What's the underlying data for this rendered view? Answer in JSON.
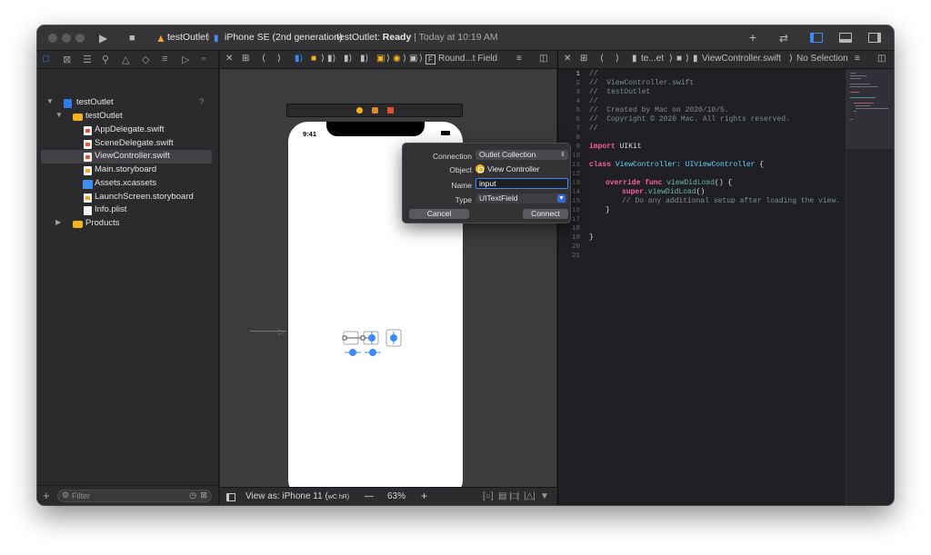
{
  "toolbar": {
    "scheme": "testOutlet",
    "destination": "iPhone SE (2nd generation)",
    "status_prefix": "testOutlet:",
    "status_state": "Ready",
    "status_time": "| Today at 10:19 AM"
  },
  "navigator": {
    "items": [
      {
        "label": "testOutlet",
        "badge": "?"
      },
      {
        "label": "testOutlet"
      },
      {
        "label": "AppDelegate.swift"
      },
      {
        "label": "SceneDelegate.swift"
      },
      {
        "label": "ViewController.swift"
      },
      {
        "label": "Main.storyboard"
      },
      {
        "label": "Assets.xcassets"
      },
      {
        "label": "LaunchScreen.storyboard"
      },
      {
        "label": "Info.plist"
      },
      {
        "label": "Products"
      }
    ],
    "filter_placeholder": "Filter"
  },
  "ib": {
    "jumpbar_last": "Round...t Field",
    "phone_time": "9:41",
    "view_as": "View as: iPhone 11 (",
    "view_as_keys": "wC hR)",
    "zoom": "63%"
  },
  "popover": {
    "connection_label": "Connection",
    "connection_value": "Outlet Collection",
    "object_label": "Object",
    "object_value": "View Controller",
    "name_label": "Name",
    "name_value": "input",
    "type_label": "Type",
    "type_value": "UITextField",
    "cancel_label": "Cancel",
    "connect_label": "Connect"
  },
  "code_editor": {
    "jump_file_short": "te...et",
    "jump_file": "ViewController.swift",
    "jump_selection": "No Selection",
    "line_numbers": [
      "1",
      "2",
      "3",
      "4",
      "5",
      "6",
      "7",
      "8",
      "9",
      "10",
      "11",
      "12",
      "13",
      "14",
      "15",
      "16",
      "17",
      "18",
      "19",
      "20",
      "21"
    ],
    "lines": {
      "l1": "//",
      "l2": "//  ViewController.swift",
      "l3": "//  testOutlet",
      "l4": "//",
      "l5": "//  Created by Mac on 2020/10/5.",
      "l6": "//  Copyright © 2020 Mac. All rights reserved.",
      "l7": "//",
      "l9_kw": "import",
      "l9_rest": " UIKit",
      "l11_kw": "class",
      "l11_name": " ViewController: ",
      "l11_type": "UIViewController",
      "l11_end": " {",
      "l13_kw": "override func",
      "l13_fn": " viewDidLoad",
      "l13_end": "() {",
      "l14_kw": "super",
      "l14_fn": ".viewDidLoad",
      "l14_end": "()",
      "l15": "// Do any additional setup after loading the view.",
      "l16": "}",
      "l19": "}"
    }
  }
}
